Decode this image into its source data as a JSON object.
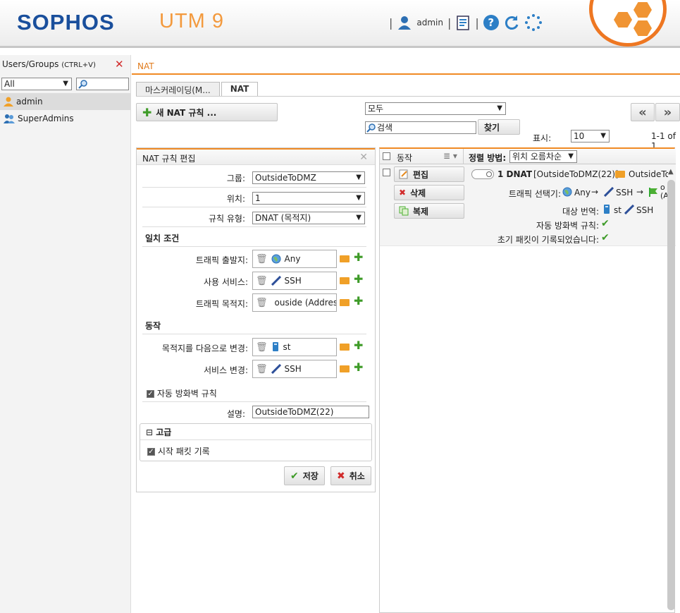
{
  "header": {
    "logo": "SOPHOS",
    "product": "UTM 9",
    "user": "admin",
    "help_glyph": "?",
    "icons": [
      "user-icon",
      "notes-icon",
      "help-icon",
      "reload-icon",
      "spinner-icon"
    ]
  },
  "left_panel": {
    "title": "Users/Groups",
    "shortcut": "(CTRL+V)",
    "filter_value": "All",
    "items": [
      {
        "label": "admin",
        "selected": true
      },
      {
        "label": "SuperAdmins",
        "selected": false
      }
    ]
  },
  "breadcrumb": "NAT",
  "tabs": [
    "마스커레이딩(M...",
    "NAT"
  ],
  "toolbar": {
    "new_rule": "새 NAT 규칙 ...",
    "filter_value": "모두",
    "search_placeholder": "검색",
    "find": "찾기",
    "show_label": "표시:",
    "show_value": "10",
    "page_info": "1-1 of 1",
    "prev": "«",
    "next": "»"
  },
  "edit": {
    "title": "NAT 규칙 편집",
    "group_label": "그룹:",
    "group_value": "OutsideToDMZ",
    "position_label": "위치:",
    "position_value": "1",
    "rule_type_label": "규칙 유형:",
    "rule_type_value": "DNAT (목적지)",
    "match_section": "일치 조건",
    "source_label": "트래픽 출발지:",
    "source_value": "Any",
    "service_label": "사용 서비스:",
    "service_value": "SSH",
    "dest_label": "트래픽 목적지:",
    "dest_value": "ouside (Address)",
    "action_section": "동작",
    "change_dest_label": "목적지를 다음으로 변경:",
    "change_dest_value": "st",
    "change_service_label": "서비스 변경:",
    "change_service_value": "SSH",
    "auto_fw": "자동 방화벽 규칙",
    "comment_label": "설명:",
    "comment_value": "OutsideToDMZ(22)",
    "advanced": "고급",
    "log_initial": "시작 패킷 기록",
    "save": "저장",
    "cancel": "취소"
  },
  "list": {
    "action_header": "동작",
    "sort_label": "정렬 방법:",
    "sort_value": "위치 오름차순",
    "row_edit": "편집",
    "row_delete": "삭제",
    "row_clone": "복제",
    "rule_title": "1 DNAT",
    "rule_group": "[OutsideToDMZ(22)]",
    "rule_group_name": "OutsideTo",
    "selector_label": "트래픽 선택기:",
    "sel_src": "Any",
    "sel_svc": "SSH",
    "sel_dst": "o",
    "sel_dst_sub": "(A",
    "arrow": "→",
    "target_label": "대상 번역:",
    "target_dst": "st",
    "target_svc": "SSH",
    "auto_fw_label": "자동 방화벽 규칙:",
    "log_label": "초기 패킷이 기록되었습니다:"
  }
}
